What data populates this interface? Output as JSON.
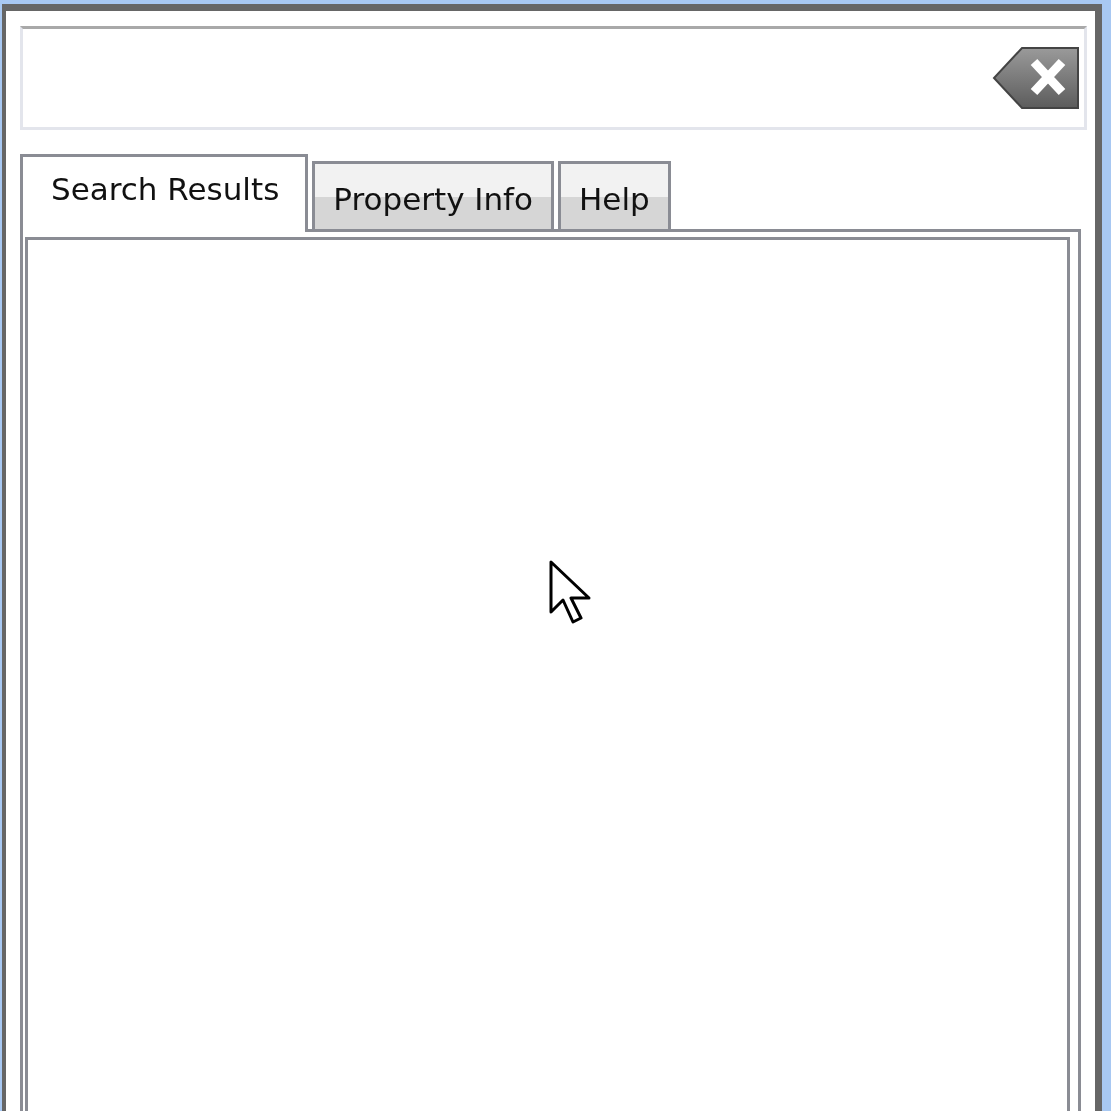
{
  "tabs": [
    {
      "label": "Search Results",
      "selected": true
    },
    {
      "label": "Property Info",
      "selected": false
    },
    {
      "label": "Help",
      "selected": false
    }
  ]
}
